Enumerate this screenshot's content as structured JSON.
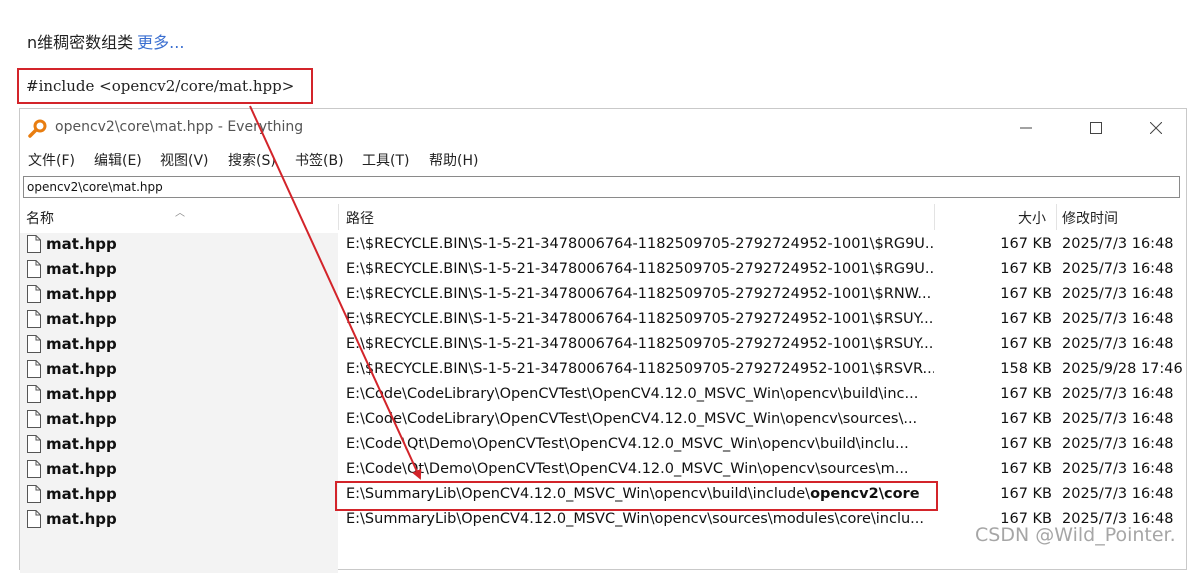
{
  "page": {
    "heading": "n维稠密数组类",
    "more_link": "更多...",
    "code": "#include <opencv2/core/mat.hpp>",
    "watermark": "CSDN @Wild_Pointer."
  },
  "window": {
    "title": "opencv2\\core\\mat.hpp - Everything",
    "menus": [
      "文件(F)",
      "编辑(E)",
      "视图(V)",
      "搜索(S)",
      "书签(B)",
      "工具(T)",
      "帮助(H)"
    ],
    "search_value": "opencv2\\core\\mat.hpp",
    "columns": {
      "name": "名称",
      "path": "路径",
      "size": "大小",
      "modified": "修改时间"
    },
    "rows": [
      {
        "name": "mat.hpp",
        "path": "E:\\$RECYCLE.BIN\\S-1-5-21-3478006764-1182509705-2792724952-1001\\$RG9U...",
        "size": "167 KB",
        "modified": "2025/7/3 16:48"
      },
      {
        "name": "mat.hpp",
        "path": "E:\\$RECYCLE.BIN\\S-1-5-21-3478006764-1182509705-2792724952-1001\\$RG9U...",
        "size": "167 KB",
        "modified": "2025/7/3 16:48"
      },
      {
        "name": "mat.hpp",
        "path": "E:\\$RECYCLE.BIN\\S-1-5-21-3478006764-1182509705-2792724952-1001\\$RNW...",
        "size": "167 KB",
        "modified": "2025/7/3 16:48"
      },
      {
        "name": "mat.hpp",
        "path": "E:\\$RECYCLE.BIN\\S-1-5-21-3478006764-1182509705-2792724952-1001\\$RSUY...",
        "size": "167 KB",
        "modified": "2025/7/3 16:48"
      },
      {
        "name": "mat.hpp",
        "path": "E:\\$RECYCLE.BIN\\S-1-5-21-3478006764-1182509705-2792724952-1001\\$RSUY...",
        "size": "167 KB",
        "modified": "2025/7/3 16:48"
      },
      {
        "name": "mat.hpp",
        "path": "E:\\$RECYCLE.BIN\\S-1-5-21-3478006764-1182509705-2792724952-1001\\$RSVR...",
        "size": "158 KB",
        "modified": "2025/9/28 17:46"
      },
      {
        "name": "mat.hpp",
        "path": "E:\\Code\\CodeLibrary\\OpenCVTest\\OpenCV4.12.0_MSVC_Win\\opencv\\build\\inc...",
        "size": "167 KB",
        "modified": "2025/7/3 16:48"
      },
      {
        "name": "mat.hpp",
        "path": "E:\\Code\\CodeLibrary\\OpenCVTest\\OpenCV4.12.0_MSVC_Win\\opencv\\sources\\...",
        "size": "167 KB",
        "modified": "2025/7/3 16:48"
      },
      {
        "name": "mat.hpp",
        "path": "E:\\Code\\Qt\\Demo\\OpenCVTest\\OpenCV4.12.0_MSVC_Win\\opencv\\build\\inclu...",
        "size": "167 KB",
        "modified": "2025/7/3 16:48"
      },
      {
        "name": "mat.hpp",
        "path": "E:\\Code\\Qt\\Demo\\OpenCVTest\\OpenCV4.12.0_MSVC_Win\\opencv\\sources\\m...",
        "size": "167 KB",
        "modified": "2025/7/3 16:48"
      },
      {
        "name": "mat.hpp",
        "path": "E:\\SummaryLib\\OpenCV4.12.0_MSVC_Win\\opencv\\build\\include\\",
        "path_bold": "opencv2\\core",
        "size": "167 KB",
        "modified": "2025/7/3 16:48"
      },
      {
        "name": "mat.hpp",
        "path": "E:\\SummaryLib\\OpenCV4.12.0_MSVC_Win\\opencv\\sources\\modules\\core\\inclu...",
        "size": "167 KB",
        "modified": "2025/7/3 16:48"
      }
    ]
  },
  "colors": {
    "annotation_red": "#d3242a",
    "link_blue": "#3b6fd0"
  },
  "icons": {
    "app": "magnifier-icon",
    "file": "document-icon",
    "minimize": "minimize-icon",
    "maximize": "maximize-icon",
    "close": "close-icon"
  }
}
